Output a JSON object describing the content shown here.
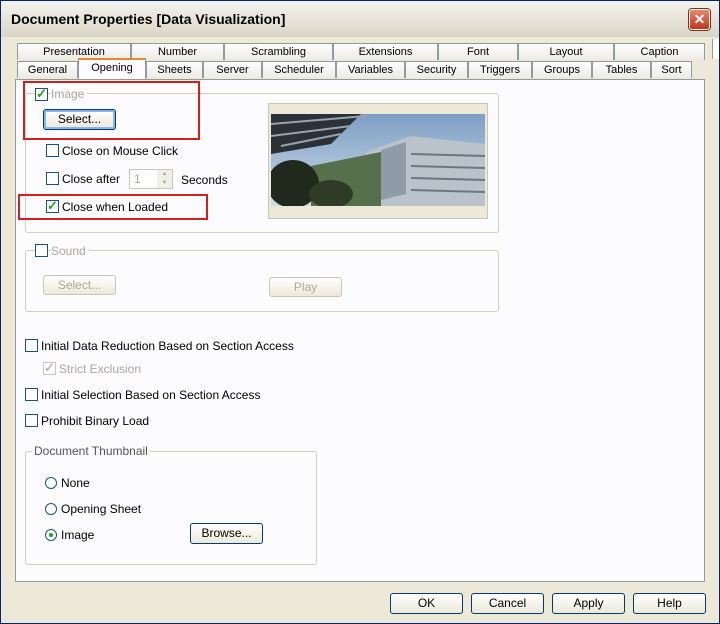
{
  "window": {
    "title": "Document Properties [Data Visualization]"
  },
  "tabs": {
    "row1": [
      "Presentation",
      "Number",
      "Scrambling",
      "Extensions",
      "Font",
      "Layout",
      "Caption"
    ],
    "row2": [
      "General",
      "Opening",
      "Sheets",
      "Server",
      "Scheduler",
      "Variables",
      "Security",
      "Triggers",
      "Groups",
      "Tables",
      "Sort"
    ],
    "active": "Opening"
  },
  "image_group": {
    "image_label": "Image",
    "image_checked": true,
    "select_label": "Select...",
    "close_on_click_label": "Close on Mouse Click",
    "close_on_click_checked": false,
    "close_after_label": "Close after",
    "close_after_checked": false,
    "close_after_value": "1",
    "seconds_label": "Seconds",
    "close_when_loaded_label": "Close when Loaded",
    "close_when_loaded_checked": true
  },
  "sound_group": {
    "sound_label": "Sound",
    "sound_checked": false,
    "select_label": "Select...",
    "play_label": "Play"
  },
  "options": {
    "initial_data_reduction_label": "Initial Data Reduction Based on Section Access",
    "strict_exclusion_label": "Strict Exclusion",
    "initial_selection_label": "Initial Selection Based on Section Access",
    "prohibit_binary_label": "Prohibit Binary Load"
  },
  "thumbnail": {
    "legend": "Document Thumbnail",
    "none_label": "None",
    "opening_sheet_label": "Opening Sheet",
    "image_label": "Image",
    "selected": "Image",
    "browse_label": "Browse..."
  },
  "buttons": {
    "ok": "OK",
    "cancel": "Cancel",
    "apply": "Apply",
    "help": "Help"
  },
  "colors": {
    "highlight": "#d02020",
    "check": "#21a121",
    "active_tab": "#e68b2c"
  }
}
